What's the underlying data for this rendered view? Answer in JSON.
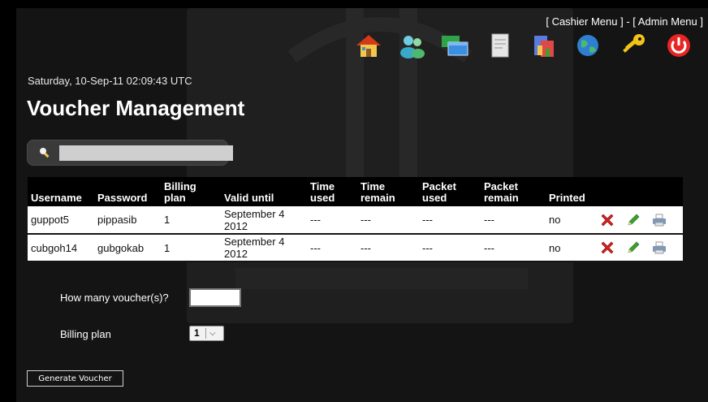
{
  "nav": {
    "cashier_menu": "[ Cashier Menu ]",
    "separator": " - ",
    "admin_menu": "[ Admin Menu ]"
  },
  "toolbar_icons": [
    "home-icon",
    "users-icon",
    "windows-icon",
    "document-icon",
    "reports-icon",
    "globe-icon",
    "key-icon",
    "power-icon"
  ],
  "datetime": "Saturday, 10-Sep-11 02:09:43 UTC",
  "page_title": "Voucher Management",
  "search": {
    "value": "",
    "placeholder": ""
  },
  "table": {
    "columns": [
      "Username",
      "Password",
      "Billing plan",
      "Valid until",
      "Time used",
      "Time remain",
      "Packet used",
      "Packet remain",
      "Printed"
    ],
    "rows": [
      {
        "username": "guppot5",
        "password": "pippasib",
        "billing_plan": "1",
        "valid_until": "September 4 2012",
        "time_used": "---",
        "time_remain": "---",
        "packet_used": "---",
        "packet_remain": "---",
        "printed": "no"
      },
      {
        "username": "cubgoh14",
        "password": "gubgokab",
        "billing_plan": "1",
        "valid_until": "September 4 2012",
        "time_used": "---",
        "time_remain": "---",
        "packet_used": "---",
        "packet_remain": "---",
        "printed": "no"
      }
    ]
  },
  "form": {
    "qty_label": "How many voucher(s)?",
    "qty_value": "",
    "plan_label": "Billing plan",
    "plan_value": "1",
    "generate_button": "Generate Voucher"
  },
  "colors": {
    "background": "#141414",
    "table_header": "#000000",
    "row_background": "#ffffff",
    "delete": "#d42020",
    "edit": "#3da02e"
  }
}
